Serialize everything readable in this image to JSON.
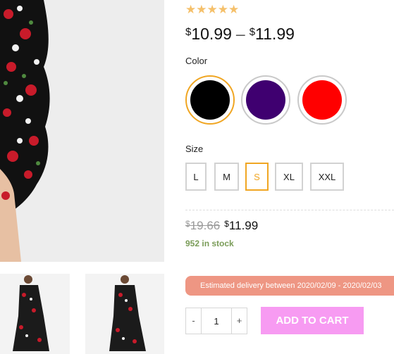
{
  "product": {
    "rating": {
      "stars_text": "★★★★★",
      "value": 5,
      "max": 5
    },
    "price_range": {
      "currency": "$",
      "min": "10.99",
      "separator": "–",
      "max": "11.99"
    }
  },
  "options": {
    "color": {
      "label": "Color",
      "swatches": [
        {
          "hex": "#000000",
          "selected": true
        },
        {
          "hex": "#3f0070",
          "selected": false
        },
        {
          "hex": "#ff0000",
          "selected": false
        }
      ]
    },
    "size": {
      "label": "Size",
      "values": [
        "L",
        "M",
        "S",
        "XL",
        "XXL"
      ],
      "selected": "S"
    }
  },
  "variation_price": {
    "currency": "$",
    "regular": "19.66",
    "sale": "11.99"
  },
  "stock": {
    "text": "952 in stock"
  },
  "delivery": {
    "text": "Estimated delivery between 2020/02/09 - 2020/02/03"
  },
  "cart": {
    "minus_label": "-",
    "plus_label": "+",
    "quantity": "1",
    "add_to_cart_label": "ADD TO CART"
  },
  "colors": {
    "accent": "#f0a623",
    "add_to_cart_bg": "#f79bf2",
    "delivery_bg": "#ee9683",
    "stock_text": "#7a9c58",
    "stars": "#f5c06a"
  }
}
